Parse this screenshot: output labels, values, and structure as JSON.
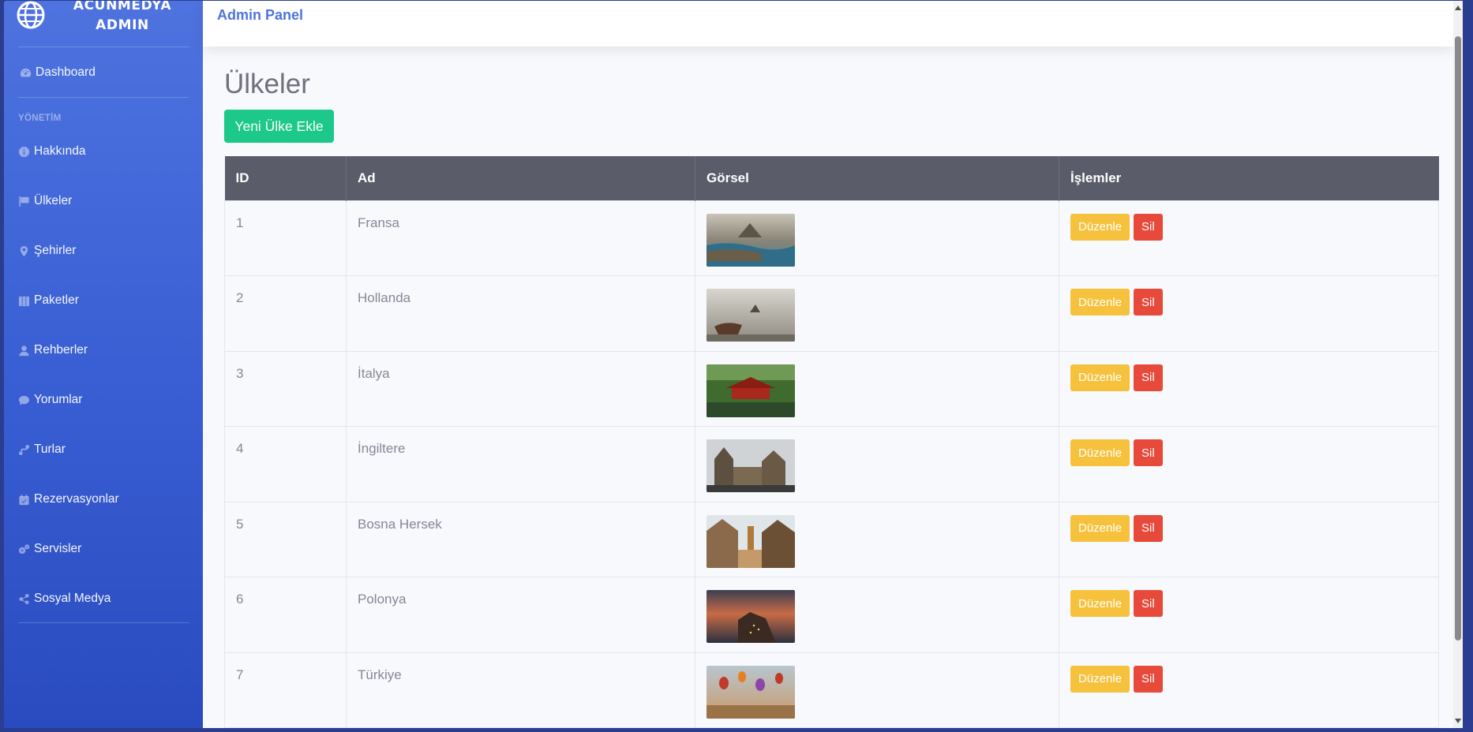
{
  "brand": {
    "line1": "ACUNMEDYA",
    "line2": "ADMIN"
  },
  "topbar": {
    "title": "Admin Panel"
  },
  "sidebar": {
    "dashboard": "Dashboard",
    "section": "YÖNETİM",
    "items": [
      {
        "label": "Hakkında",
        "icon": "info-icon"
      },
      {
        "label": "Ülkeler",
        "icon": "flag-icon"
      },
      {
        "label": "Şehirler",
        "icon": "map-pin-icon"
      },
      {
        "label": "Paketler",
        "icon": "box-icon"
      },
      {
        "label": "Rehberler",
        "icon": "user-icon"
      },
      {
        "label": "Yorumlar",
        "icon": "comment-icon"
      },
      {
        "label": "Turlar",
        "icon": "route-icon"
      },
      {
        "label": "Rezervasyonlar",
        "icon": "calendar-check-icon"
      },
      {
        "label": "Servisler",
        "icon": "cogs-icon"
      },
      {
        "label": "Sosyal Medya",
        "icon": "share-icon"
      }
    ]
  },
  "main": {
    "title": "Ülkeler",
    "add_button": "Yeni Ülke Ekle",
    "table": {
      "headers": [
        "ID",
        "Ad",
        "Görsel",
        "İşlemler"
      ],
      "edit_label": "Düzenle",
      "delete_label": "Sil",
      "rows": [
        {
          "id": "1",
          "name": "Fransa"
        },
        {
          "id": "2",
          "name": "Hollanda"
        },
        {
          "id": "3",
          "name": "İtalya"
        },
        {
          "id": "4",
          "name": "İngiltere"
        },
        {
          "id": "5",
          "name": "Bosna Hersek"
        },
        {
          "id": "6",
          "name": "Polonya"
        },
        {
          "id": "7",
          "name": "Türkiye"
        }
      ]
    }
  },
  "colors": {
    "primary": "#4e73df",
    "success": "#1cc88a",
    "warning": "#f6c23e",
    "danger": "#e74a3b",
    "header": "#5a5c69"
  }
}
